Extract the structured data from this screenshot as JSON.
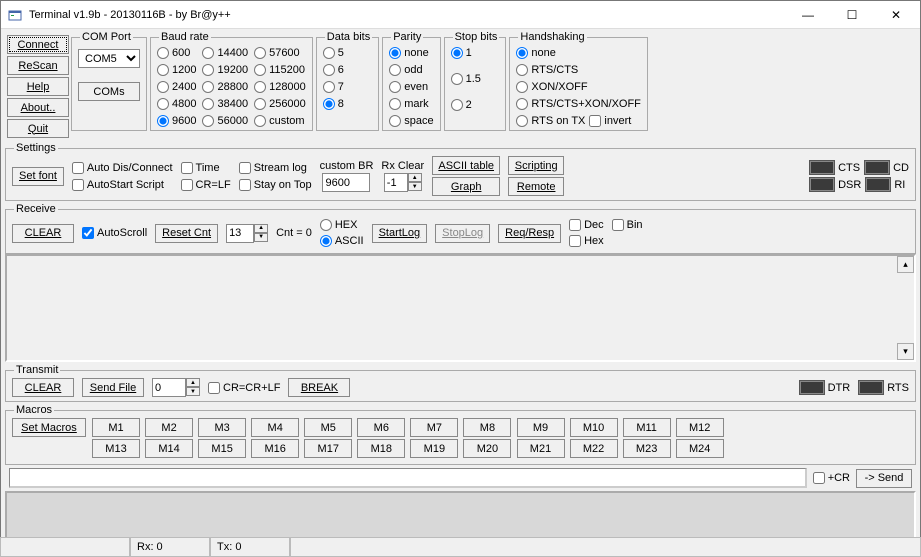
{
  "window": {
    "title": "Terminal v1.9b - 20130116B - by Br@y++",
    "min_glyph": "—",
    "max_glyph": "☐",
    "close_glyph": "✕"
  },
  "left_buttons": {
    "connect": "Connect",
    "rescan": "ReScan",
    "help": "Help",
    "about": "About..",
    "quit": "Quit"
  },
  "com_port": {
    "legend": "COM Port",
    "selected": "COM5",
    "coms_btn": "COMs"
  },
  "baud": {
    "legend": "Baud rate",
    "options": [
      "600",
      "1200",
      "2400",
      "4800",
      "9600",
      "14400",
      "19200",
      "28800",
      "38400",
      "56000",
      "57600",
      "115200",
      "128000",
      "256000",
      "custom"
    ],
    "selected": "9600"
  },
  "databits": {
    "legend": "Data bits",
    "options": [
      "5",
      "6",
      "7",
      "8"
    ],
    "selected": "8"
  },
  "parity": {
    "legend": "Parity",
    "options": [
      "none",
      "odd",
      "even",
      "mark",
      "space"
    ],
    "selected": "none"
  },
  "stopbits": {
    "legend": "Stop bits",
    "options": [
      "1",
      "1.5",
      "2"
    ],
    "selected": "1"
  },
  "handshake": {
    "legend": "Handshaking",
    "options": [
      "none",
      "RTS/CTS",
      "XON/XOFF",
      "RTS/CTS+XON/XOFF",
      "RTS on TX"
    ],
    "selected": "none",
    "invert_label": "invert"
  },
  "settings": {
    "legend": "Settings",
    "setfont_btn": "Set font",
    "auto_disconnect": "Auto Dis/Connect",
    "autostart_script": "AutoStart Script",
    "time": "Time",
    "crlf": "CR=LF",
    "stream_log": "Stream log",
    "stay_on_top": "Stay on Top",
    "custom_br_label": "custom BR",
    "custom_br_value": "9600",
    "rxclear_label": "Rx Clear",
    "rxclear_value": "-1",
    "ascii_table_btn": "ASCII table",
    "graph_btn": "Graph",
    "scripting_btn": "Scripting",
    "remote_btn": "Remote"
  },
  "leds": {
    "cts": "CTS",
    "cd": "CD",
    "dsr": "DSR",
    "ri": "RI",
    "dtr": "DTR",
    "rts": "RTS"
  },
  "receive": {
    "legend": "Receive",
    "clear_btn": "CLEAR",
    "autoscroll": "AutoScroll",
    "resetcnt_btn": "Reset Cnt",
    "cnt_value": "13",
    "cnt_label": "Cnt = 0",
    "hex": "HEX",
    "ascii": "ASCII",
    "startlog_btn": "StartLog",
    "stoplog_btn": "StopLog",
    "reqresp_btn": "Req/Resp",
    "dec": "Dec",
    "hex2": "Hex",
    "bin": "Bin"
  },
  "transmit": {
    "legend": "Transmit",
    "clear_btn": "CLEAR",
    "sendfile_btn": "Send File",
    "num_value": "0",
    "crcrlf": "CR=CR+LF",
    "break_btn": "BREAK"
  },
  "macros": {
    "legend": "Macros",
    "set_btn": "Set Macros",
    "row1": [
      "M1",
      "M2",
      "M3",
      "M4",
      "M5",
      "M6",
      "M7",
      "M8",
      "M9",
      "M10",
      "M11",
      "M12"
    ],
    "row2": [
      "M13",
      "M14",
      "M15",
      "M16",
      "M17",
      "M18",
      "M19",
      "M20",
      "M21",
      "M22",
      "M23",
      "M24"
    ]
  },
  "send": {
    "cr_label": "+CR",
    "send_btn": "-> Send"
  },
  "status": {
    "rx": "Rx: 0",
    "tx": "Tx: 0"
  }
}
